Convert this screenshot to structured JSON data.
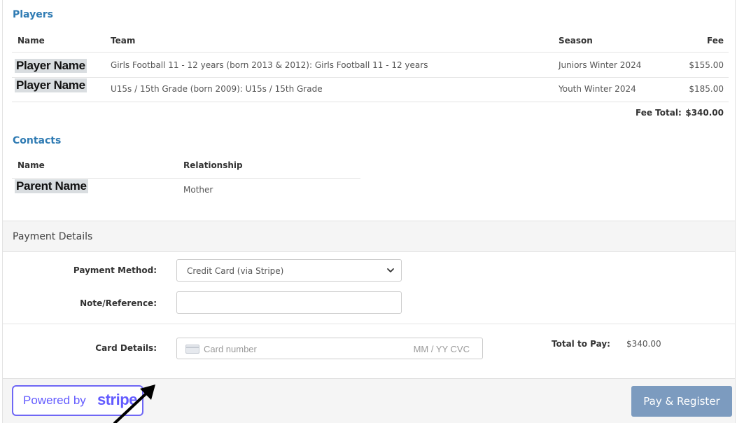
{
  "players": {
    "title": "Players",
    "headers": {
      "name": "Name",
      "team": "Team",
      "season": "Season",
      "fee": "Fee"
    },
    "rows": [
      {
        "name": "Player Name",
        "team": "Girls Football 11 - 12 years (born 2013 & 2012): Girls Football 11 - 12 years",
        "season": "Juniors Winter 2024",
        "fee": "$155.00"
      },
      {
        "name": "Player Name",
        "team": "U15s / 15th Grade (born 2009): U15s / 15th Grade",
        "season": "Youth Winter 2024",
        "fee": "$185.00"
      }
    ],
    "fee_total_label": "Fee Total:",
    "fee_total_value": "$340.00"
  },
  "contacts": {
    "title": "Contacts",
    "headers": {
      "name": "Name",
      "relationship": "Relationship"
    },
    "rows": [
      {
        "name": "Parent Name",
        "relationship": "Mother"
      }
    ]
  },
  "payment": {
    "title": "Payment Details",
    "method_label": "Payment Method:",
    "method_value": "Credit Card (via Stripe)",
    "note_label": "Note/Reference:",
    "note_value": "",
    "card_label": "Card Details:",
    "card_placeholder": "Card number",
    "card_exp_placeholder": "MM / YY  CVC",
    "total_label": "Total to Pay:",
    "total_value": "$340.00"
  },
  "footer": {
    "stripe_prefix": "Powered by",
    "stripe_brand": "stripe",
    "pay_button": "Pay & Register"
  },
  "colors": {
    "accent": "#2f7bb3",
    "button": "#7c9bbf",
    "stripe": "#635bff"
  }
}
